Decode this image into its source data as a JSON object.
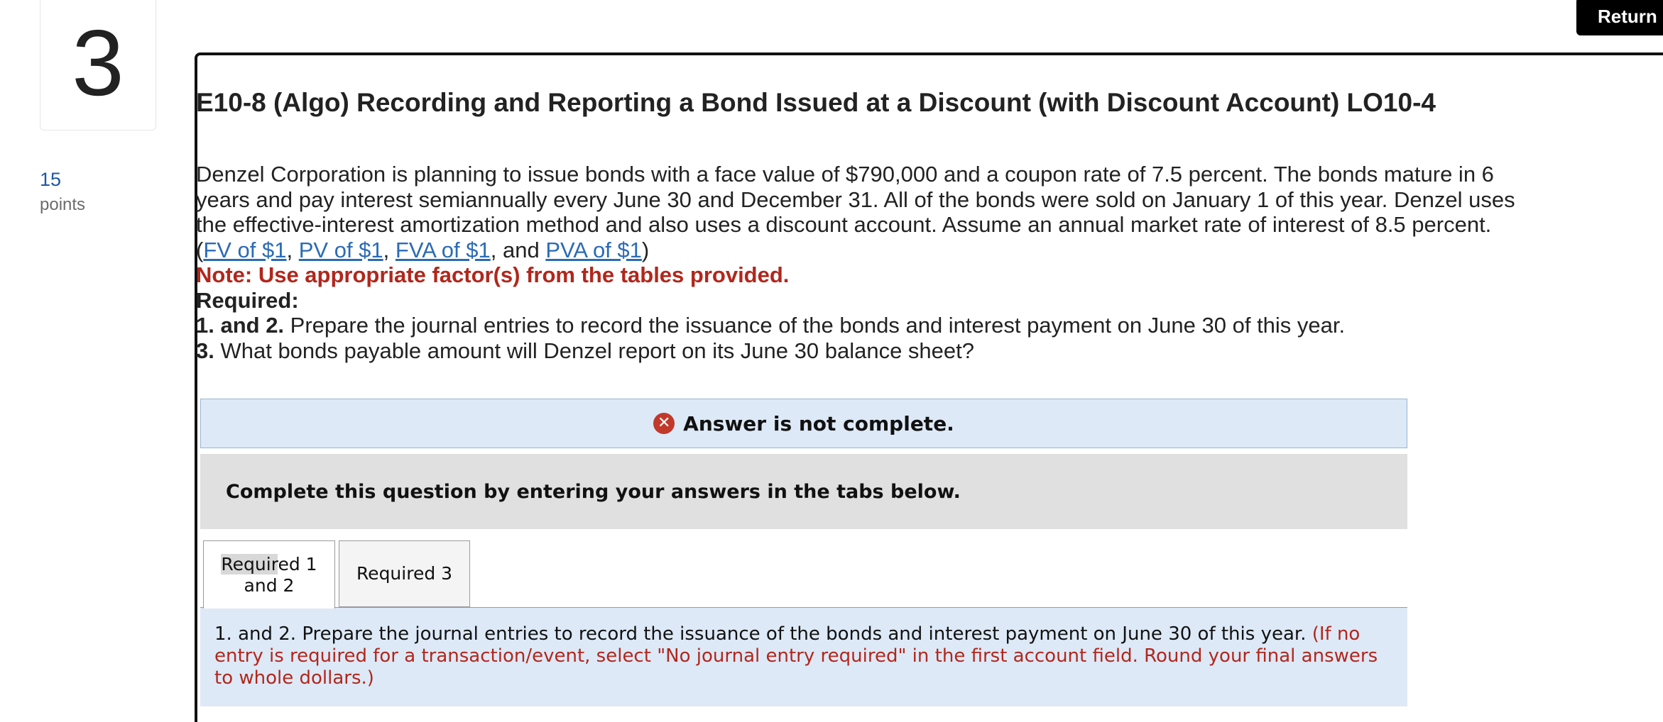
{
  "question": {
    "number": "3",
    "points_value": "15",
    "points_label": "points"
  },
  "header": {
    "return_label": "Return"
  },
  "problem": {
    "title": "E10-8 (Algo) Recording and Reporting a Bond Issued at a Discount (with Discount Account) LO10-4",
    "body": "Denzel Corporation is planning to issue bonds with a face value of $790,000 and a coupon rate of 7.5 percent. The bonds mature in 6 years and pay interest semiannually every June 30 and December 31. All of the bonds were sold on January 1 of this year. Denzel uses the effective-interest amortization method and also uses a discount account. Assume an annual market rate of interest of 8.5 percent.",
    "links": {
      "open_paren": "(",
      "fv": "FV of $1",
      "sep1": ", ",
      "pv": "PV of $1",
      "sep2": ", ",
      "fva": "FVA of $1",
      "and": ", and ",
      "pva": "PVA of $1",
      "close_paren": ")"
    },
    "note": "Note: Use appropriate factor(s) from the tables provided.",
    "required_label": "Required:",
    "req1_bold": "1. and 2.",
    "req1_text": " Prepare the journal entries to record the issuance of the bonds and interest payment on June 30 of this year.",
    "req3_bold": "3.",
    "req3_text": " What bonds payable amount will Denzel report on its June 30 balance sheet?"
  },
  "alert": {
    "text": "Answer is not complete.",
    "icon": "error-x-icon",
    "icon_color": "#c0392b"
  },
  "instructions": {
    "text": "Complete this question by entering your answers in the tabs below."
  },
  "tabs": [
    {
      "label_part1": "Requir",
      "label_part2": "ed 1",
      "label_line2": "and 2",
      "active": true
    },
    {
      "label": "Required 3",
      "active": false
    }
  ],
  "tab_content": {
    "text": "1. and 2. Prepare the journal entries to record the issuance of the bonds and interest payment on June 30 of this year.",
    "instruction": "(If no entry is required for a transaction/event, select \"No journal entry required\" in the first account field. Round your final answers to whole dollars.)"
  },
  "colors": {
    "link": "#2a6bb5",
    "note_red": "#b1271c",
    "alert_bg": "#dde9f7",
    "instructions_bg": "#e0e0e0"
  }
}
